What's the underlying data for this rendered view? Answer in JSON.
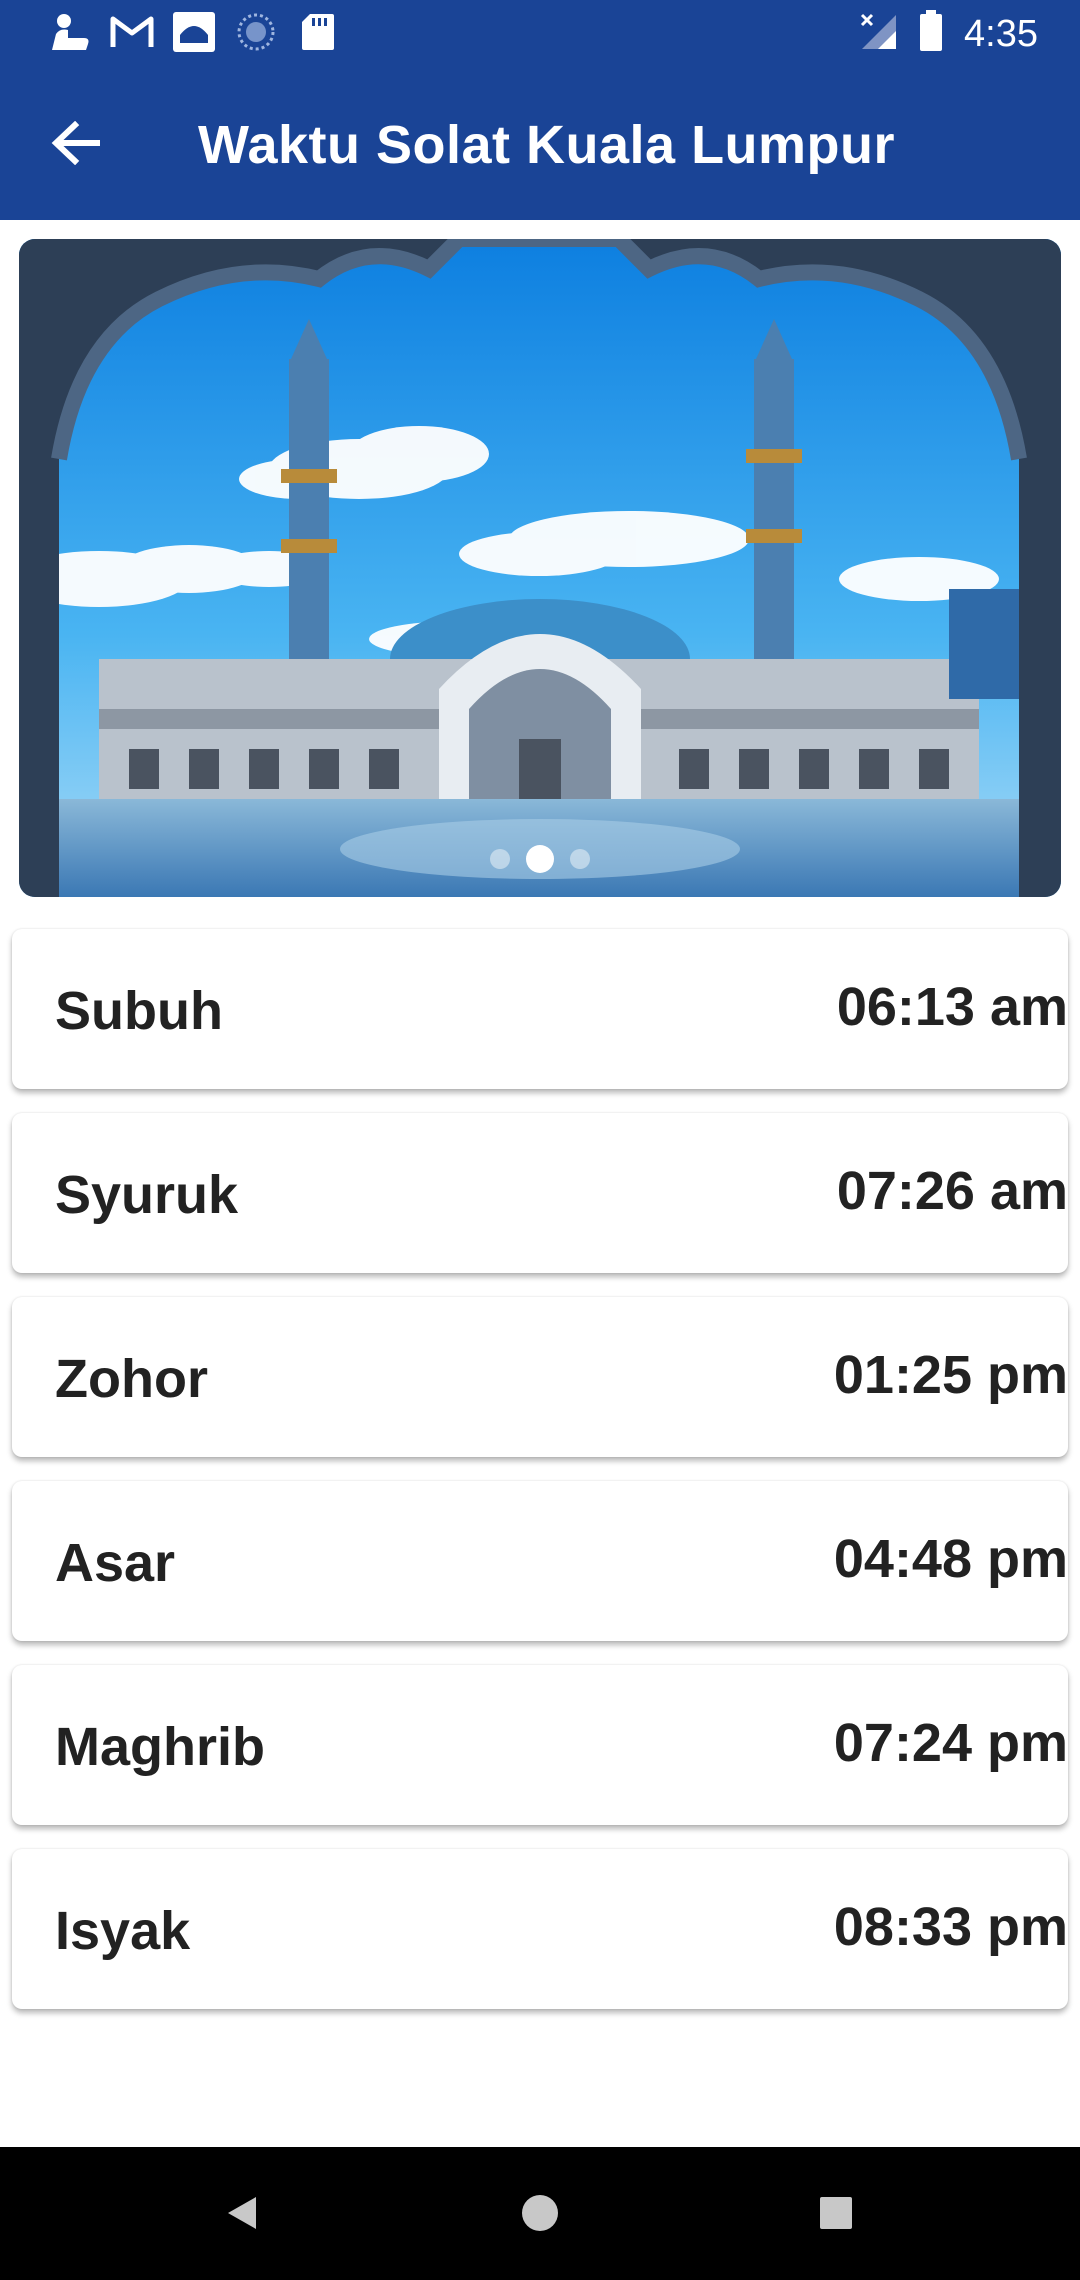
{
  "status_bar": {
    "time": "4:35",
    "left_icons": [
      "person-icon",
      "gmail-icon",
      "mosque-icon",
      "sync-icon",
      "sd-card-icon"
    ],
    "right_icons": [
      "no-signal-icon",
      "battery-icon"
    ]
  },
  "app_bar": {
    "title": "Waktu Solat Kuala Lumpur",
    "back_icon": "arrow-left-icon"
  },
  "banner": {
    "image": "mosque-photo",
    "slide_count": 3,
    "active_slide": 2
  },
  "prayers": [
    {
      "name": "Subuh",
      "time": "06:13 am"
    },
    {
      "name": "Syuruk",
      "time": "07:26 am"
    },
    {
      "name": "Zohor",
      "time": "01:25 pm"
    },
    {
      "name": "Asar",
      "time": "04:48 pm"
    },
    {
      "name": "Maghrib",
      "time": "07:24 pm"
    },
    {
      "name": "Isyak",
      "time": "08:33 pm"
    }
  ],
  "nav_bar": {
    "buttons": [
      "back-triangle-icon",
      "home-circle-icon",
      "recents-square-icon"
    ]
  },
  "colors": {
    "primary": "#1a4496",
    "row_text": "#222222",
    "nav_bar": "#000000"
  }
}
